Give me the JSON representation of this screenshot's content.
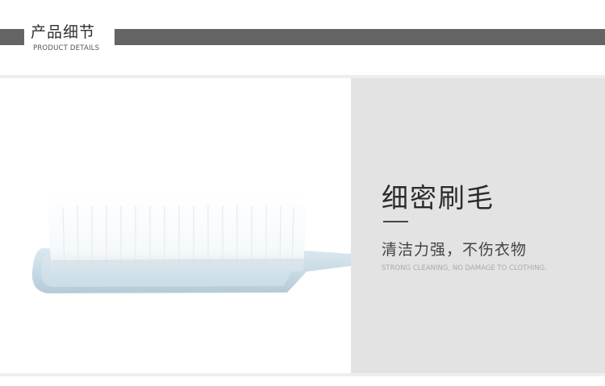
{
  "header": {
    "title": "产品细节",
    "subtitle": "PRODUCT DETAILS"
  },
  "feature": {
    "title": "细密刷毛",
    "description": "清洁力强，不伤衣物",
    "description_en": "STRONG CLEANING, NO DAMAGE TO CLOTHING."
  },
  "colors": {
    "header_bar": "#646464",
    "info_panel": "#e3e3e3",
    "brush_handle": "#cfe0ea",
    "bristles": "#ffffff"
  }
}
